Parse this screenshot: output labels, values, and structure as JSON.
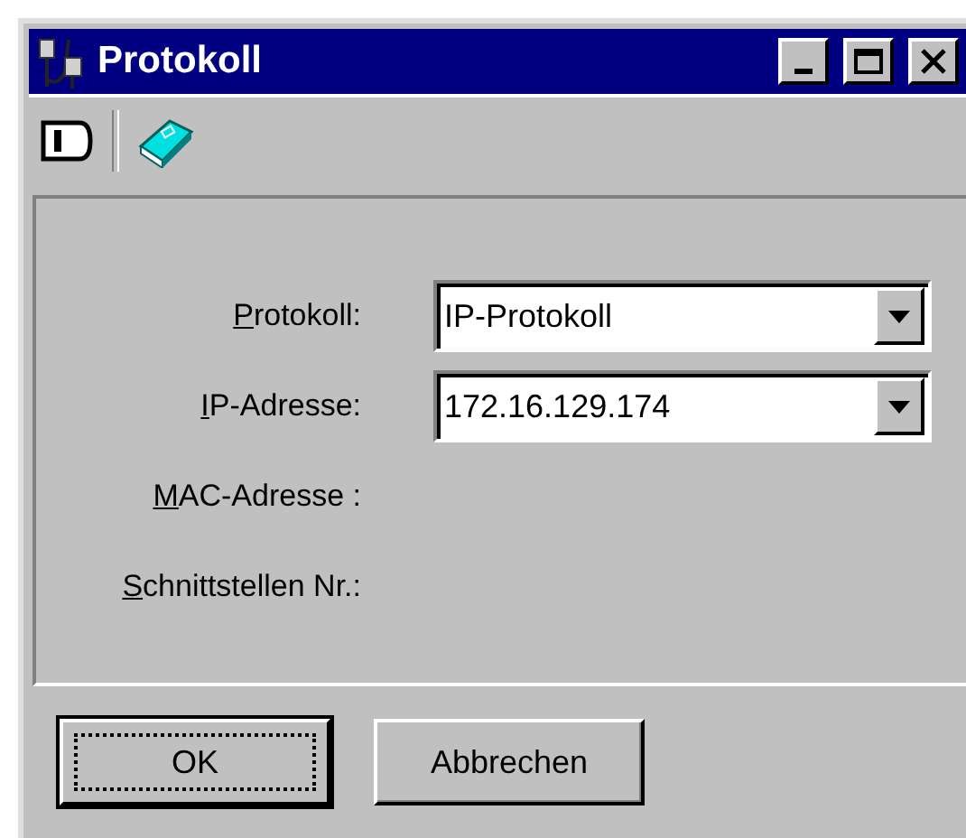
{
  "window": {
    "title": "Protokoll"
  },
  "fields": [
    {
      "label": "Protokoll:",
      "value": "IP-Protokoll",
      "kind": "combo"
    },
    {
      "label": "IP-Adresse:",
      "value": "172.16.129.174",
      "kind": "combo"
    },
    {
      "label": "MAC-Adresse :",
      "kind": "empty"
    },
    {
      "label": "Schnittstellen Nr.:",
      "kind": "empty"
    }
  ],
  "buttons": [
    {
      "label": "OK",
      "selected": true
    },
    {
      "label": "Abbrechen",
      "selected": false
    }
  ]
}
